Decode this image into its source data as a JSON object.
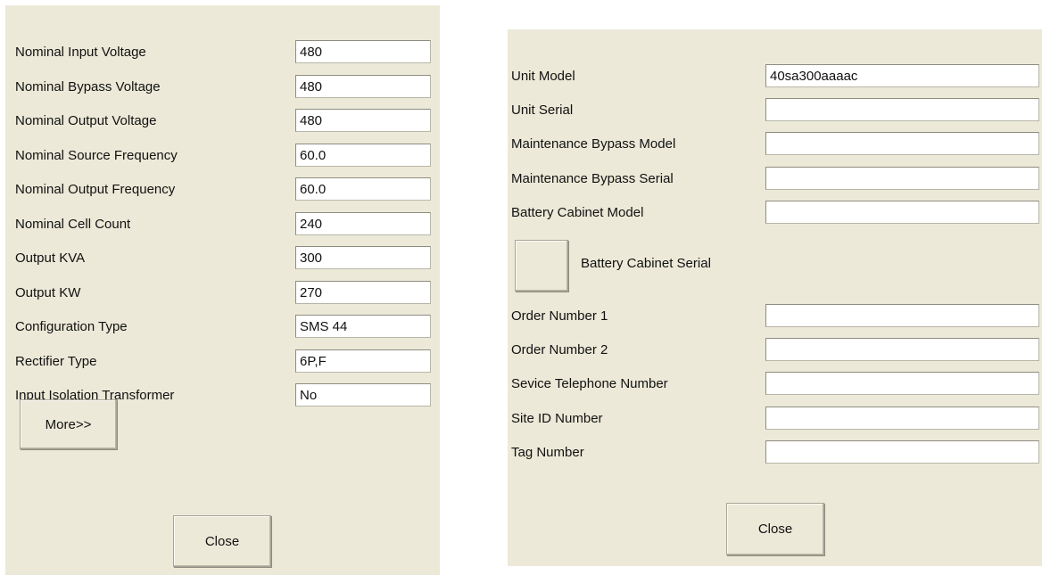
{
  "left_dialog": {
    "fields": [
      {
        "label": "Nominal Input Voltage",
        "value": "480"
      },
      {
        "label": "Nominal Bypass Voltage",
        "value": "480"
      },
      {
        "label": "Nominal Output Voltage",
        "value": "480"
      },
      {
        "label": "Nominal Source Frequency",
        "value": "60.0"
      },
      {
        "label": "Nominal Output Frequency",
        "value": "60.0"
      },
      {
        "label": "Nominal Cell Count",
        "value": "240"
      },
      {
        "label": "Output KVA",
        "value": "300"
      },
      {
        "label": "Output KW",
        "value": "270"
      },
      {
        "label": "Configuration Type",
        "value": "SMS 44"
      },
      {
        "label": "Rectifier Type",
        "value": "6P,F"
      },
      {
        "label": "Input Isolation Transformer",
        "value": "No"
      }
    ],
    "more_label": "More>>",
    "close_label": "Close"
  },
  "right_dialog": {
    "fields_top": [
      {
        "label": "Unit Model",
        "value": "40sa300aaaac"
      },
      {
        "label": "Unit Serial",
        "value": ""
      },
      {
        "label": "Maintenance Bypass Model",
        "value": ""
      },
      {
        "label": "Maintenance Bypass Serial",
        "value": ""
      },
      {
        "label": "Battery Cabinet Model",
        "value": ""
      }
    ],
    "battery_cabinet_serial_label": "Battery Cabinet Serial",
    "fields_bottom": [
      {
        "label": "Order Number 1",
        "value": ""
      },
      {
        "label": "Order Number 2",
        "value": ""
      },
      {
        "label": "Sevice Telephone Number",
        "value": ""
      },
      {
        "label": "Site ID Number",
        "value": ""
      },
      {
        "label": "Tag Number",
        "value": ""
      }
    ],
    "close_label": "Close"
  },
  "colors": {
    "panel_background": "#ece9d8",
    "field_background": "#ffffff"
  }
}
